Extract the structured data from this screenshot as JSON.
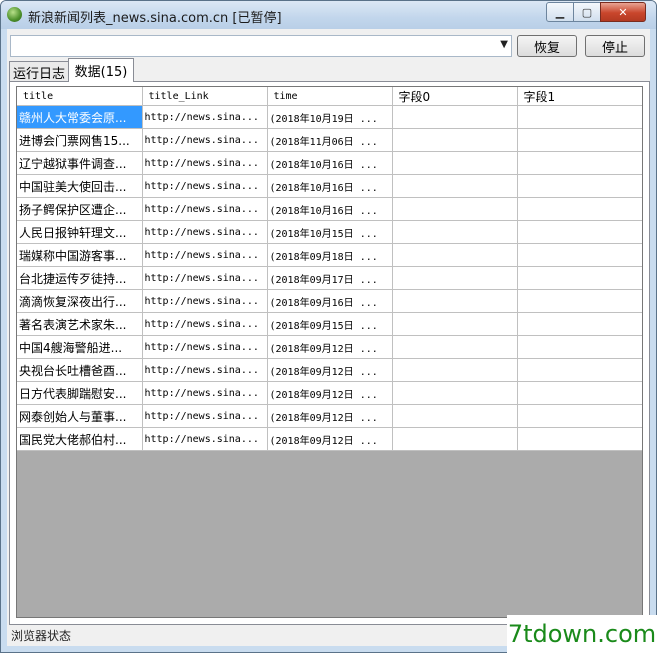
{
  "window": {
    "title": "新浪新闻列表_news.sina.com.cn [已暂停]"
  },
  "toolbar": {
    "url_value": "",
    "restore_label": "恢复",
    "stop_label": "停止"
  },
  "tabs": [
    {
      "label": "运行日志",
      "active": false
    },
    {
      "label": "数据(15)",
      "active": true
    }
  ],
  "table": {
    "columns": [
      "title",
      "title_Link",
      "time",
      "字段0",
      "字段1"
    ],
    "rows": [
      [
        "赣州人大常委会原...",
        "http://news.sina...",
        "(2018年10月19日 ...",
        "",
        ""
      ],
      [
        "进博会门票网售15...",
        "http://news.sina...",
        "(2018年11月06日 ...",
        "",
        ""
      ],
      [
        "辽宁越狱事件调查...",
        "http://news.sina...",
        "(2018年10月16日 ...",
        "",
        ""
      ],
      [
        "中国驻美大使回击...",
        "http://news.sina...",
        "(2018年10月16日 ...",
        "",
        ""
      ],
      [
        "扬子鳄保护区遭企...",
        "http://news.sina...",
        "(2018年10月16日 ...",
        "",
        ""
      ],
      [
        "人民日报钟轩理文...",
        "http://news.sina...",
        "(2018年10月15日 ...",
        "",
        ""
      ],
      [
        "瑞媒称中国游客事...",
        "http://news.sina...",
        "(2018年09月18日 ...",
        "",
        ""
      ],
      [
        "台北捷运传歹徒持...",
        "http://news.sina...",
        "(2018年09月17日 ...",
        "",
        ""
      ],
      [
        "滴滴恢复深夜出行...",
        "http://news.sina...",
        "(2018年09月16日 ...",
        "",
        ""
      ],
      [
        "著名表演艺术家朱...",
        "http://news.sina...",
        "(2018年09月15日 ...",
        "",
        ""
      ],
      [
        "中国4艘海警船进...",
        "http://news.sina...",
        "(2018年09月12日 ...",
        "",
        ""
      ],
      [
        "央视台长吐槽爸酉...",
        "http://news.sina...",
        "(2018年09月12日 ...",
        "",
        ""
      ],
      [
        "日方代表脚踹慰安...",
        "http://news.sina...",
        "(2018年09月12日 ...",
        "",
        ""
      ],
      [
        "网泰创始人与董事...",
        "http://news.sina...",
        "(2018年09月12日 ...",
        "",
        ""
      ],
      [
        "国民党大佬郝伯村...",
        "http://news.sina...",
        "(2018年09月12日 ...",
        "",
        ""
      ]
    ],
    "selected_row": 0
  },
  "status": {
    "text": "浏览器状态"
  },
  "watermark": "7tdown.com",
  "colors": {
    "selection": "#3399ff",
    "titlebar": "#c9dcef",
    "empty_grid": "#ababab"
  }
}
